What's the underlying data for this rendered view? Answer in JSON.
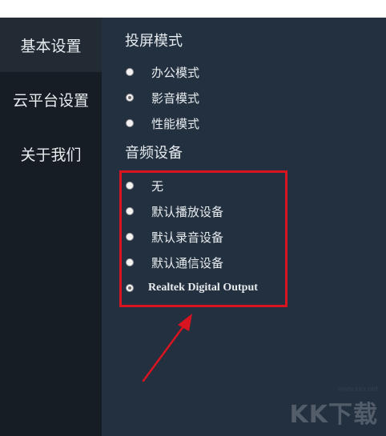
{
  "sidebar": {
    "items": [
      {
        "label": "基本设置"
      },
      {
        "label": "云平台设置"
      },
      {
        "label": "关于我们"
      }
    ]
  },
  "main": {
    "cast_mode": {
      "title": "投屏模式",
      "options": [
        {
          "label": "办公模式",
          "checked": false
        },
        {
          "label": "影音模式",
          "checked": true
        },
        {
          "label": "性能模式",
          "checked": false
        }
      ]
    },
    "audio_device": {
      "title": "音频设备",
      "options": [
        {
          "label": "无",
          "checked": false
        },
        {
          "label": "默认播放设备",
          "checked": false
        },
        {
          "label": "默认录音设备",
          "checked": false
        },
        {
          "label": "默认通信设备",
          "checked": false
        },
        {
          "label": "Realtek Digital Output",
          "checked": true
        }
      ]
    }
  },
  "annotation": {
    "highlight_color": "#d7141f"
  },
  "watermark": {
    "url": "www.kkx.net",
    "logo": "KK下载"
  },
  "colors": {
    "sidebar_bg": "#171d24",
    "sidebar_active_bg": "#222b34",
    "main_bg": "#233040",
    "text": "#e7ecef"
  }
}
